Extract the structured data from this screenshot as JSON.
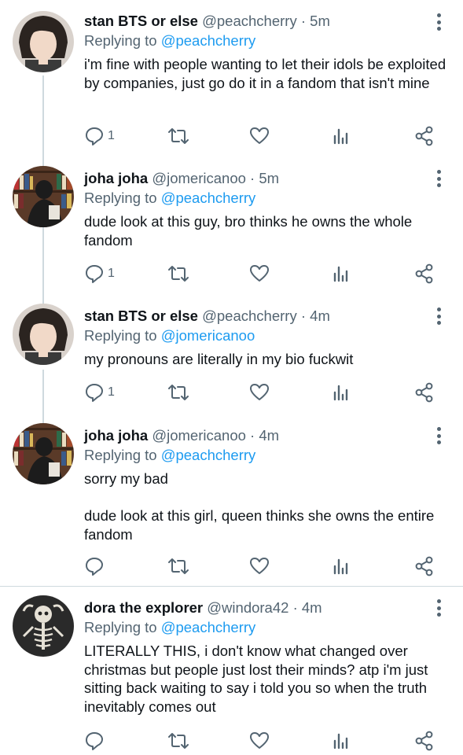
{
  "tweets": [
    {
      "name": "stan BTS or else",
      "handle": "@peachcherry",
      "time": "5m",
      "reply_prefix": "Replying to",
      "reply_to": "@peachcherry",
      "text": "i'm fine with people wanting to let their idols be exploited by companies, just go do it in a fandom that isn't mine",
      "reply_count": "1",
      "avatar": "profile-photo-person"
    },
    {
      "name": "joha joha",
      "handle": "@jomericanoo",
      "time": "5m",
      "reply_prefix": "Replying to",
      "reply_to": "@peachcherry",
      "text": "dude look at this guy, bro thinks he owns the whole fandom",
      "reply_count": "1",
      "avatar": "profile-photo-bookshelf"
    },
    {
      "name": "stan BTS or else",
      "handle": "@peachcherry",
      "time": "4m",
      "reply_prefix": "Replying to",
      "reply_to": "@jomericanoo",
      "text": "my pronouns are literally in my bio fuckwit",
      "reply_count": "1",
      "avatar": "profile-photo-person"
    },
    {
      "name": "joha joha",
      "handle": "@jomericanoo",
      "time": "4m",
      "reply_prefix": "Replying to",
      "reply_to": "@peachcherry",
      "text": "sorry my bad\n\ndude look at this girl, queen thinks she owns the entire fandom",
      "reply_count": "",
      "avatar": "profile-photo-bookshelf"
    },
    {
      "name": "dora the explorer",
      "handle": "@windora42",
      "time": "4m",
      "reply_prefix": "Replying to",
      "reply_to": "@peachcherry",
      "text": "LITERALLY THIS, i don't know what changed over christmas but people just lost their minds? atp i'm just sitting back waiting to say i told you so when the truth inevitably comes out",
      "reply_count": "",
      "avatar": "profile-photo-skeleton"
    }
  ],
  "separator": "·",
  "icons": [
    "reply-icon",
    "retweet-icon",
    "like-icon",
    "analytics-icon",
    "share-icon",
    "more-options-icon"
  ],
  "colors": {
    "text": "#0f1419",
    "secondary": "#536471",
    "link": "#1d9bf0",
    "divider": "#cfd9de"
  }
}
